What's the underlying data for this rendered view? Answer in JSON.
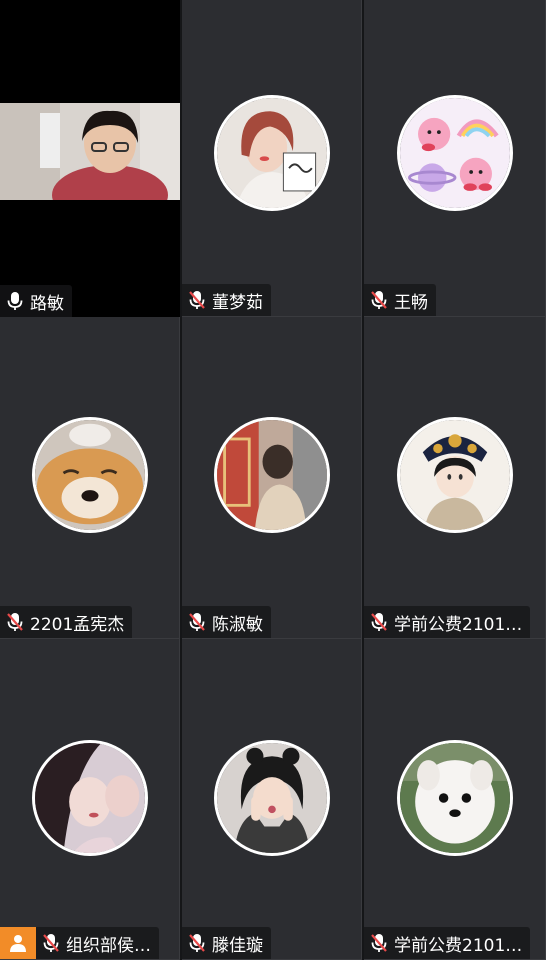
{
  "participants": [
    {
      "name": "路敏",
      "mic": "on"
    },
    {
      "name": "董梦茹",
      "mic": "muted"
    },
    {
      "name": "王畅",
      "mic": "muted"
    },
    {
      "name": "2201孟宪杰",
      "mic": "muted"
    },
    {
      "name": "陈淑敏",
      "mic": "muted"
    },
    {
      "name": "学前公费2101…",
      "mic": "muted"
    },
    {
      "name": "组织部侯…",
      "mic": "muted"
    },
    {
      "name": "滕佳璇",
      "mic": "muted"
    },
    {
      "name": "学前公费2101…",
      "mic": "muted"
    }
  ],
  "icons": {
    "mic_on": "microphone-icon",
    "mic_muted": "microphone-muted-icon",
    "participants": "person-icon"
  },
  "colors": {
    "muted_accent": "#e84a4a",
    "badge": "#f28c28",
    "tile_bg": "#2c2d31"
  }
}
